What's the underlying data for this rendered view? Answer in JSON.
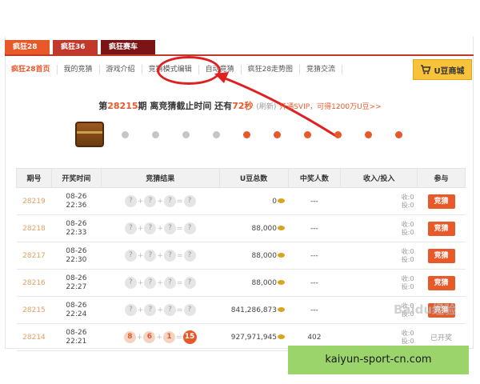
{
  "tabs": [
    "疯狂28",
    "疯狂36",
    "疯狂赛车"
  ],
  "nav": {
    "items": [
      "疯狂28首页",
      "我的竞猜",
      "游戏介绍",
      "竞猜模式编辑",
      "自动竞猜",
      "疯狂28走势图",
      "竞猜交流"
    ],
    "shop": "U豆商城"
  },
  "status": {
    "prefix": "第",
    "round": "28215",
    "mid": "期 离竞猜截止时间 还有",
    "seconds": "72秒",
    "refresh": "(刷新)",
    "promo": "开通SVIP，可得1200万U豆>>"
  },
  "table": {
    "headers": [
      "期号",
      "开奖时间",
      "竞猜结果",
      "U豆总数",
      "中奖人数",
      "收入/投入",
      "参与"
    ],
    "rows": [
      {
        "id": "28219",
        "date": "08-26",
        "time": "22:36",
        "balls": [
          "?",
          "?",
          "?",
          "?"
        ],
        "total": "0",
        "winners": "---",
        "income": "收:0",
        "spend": "投:0",
        "action": "竞猜"
      },
      {
        "id": "28218",
        "date": "08-26",
        "time": "22:33",
        "balls": [
          "?",
          "?",
          "?",
          "?"
        ],
        "total": "88,000",
        "winners": "---",
        "income": "收:0",
        "spend": "投:0",
        "action": "竞猜"
      },
      {
        "id": "28217",
        "date": "08-26",
        "time": "22:30",
        "balls": [
          "?",
          "?",
          "?",
          "?"
        ],
        "total": "88,000",
        "winners": "---",
        "income": "收:0",
        "spend": "投:0",
        "action": "竞猜"
      },
      {
        "id": "28216",
        "date": "08-26",
        "time": "22:27",
        "balls": [
          "?",
          "?",
          "?",
          "?"
        ],
        "total": "88,000",
        "winners": "---",
        "income": "收:0",
        "spend": "投:0",
        "action": "竞猜"
      },
      {
        "id": "28215",
        "date": "08-26",
        "time": "22:24",
        "balls": [
          "?",
          "?",
          "?",
          "?"
        ],
        "total": "841,286,873",
        "winners": "---",
        "income": "收:0",
        "spend": "投:0",
        "action": "竞猜"
      },
      {
        "id": "28214",
        "date": "08-26",
        "time": "22:21",
        "balls": [
          "8",
          "6",
          "1",
          "15"
        ],
        "total": "927,971,945",
        "winners": "402",
        "income": "收:0",
        "spend": "投:0",
        "action": "已开奖"
      }
    ]
  },
  "footer": "kaiyun-sport-cn.com",
  "watermark": "Baidu经验",
  "colors": {
    "accent": "#e8592a",
    "annotation": "#e02020",
    "footer_bg": "#9bd46a"
  }
}
